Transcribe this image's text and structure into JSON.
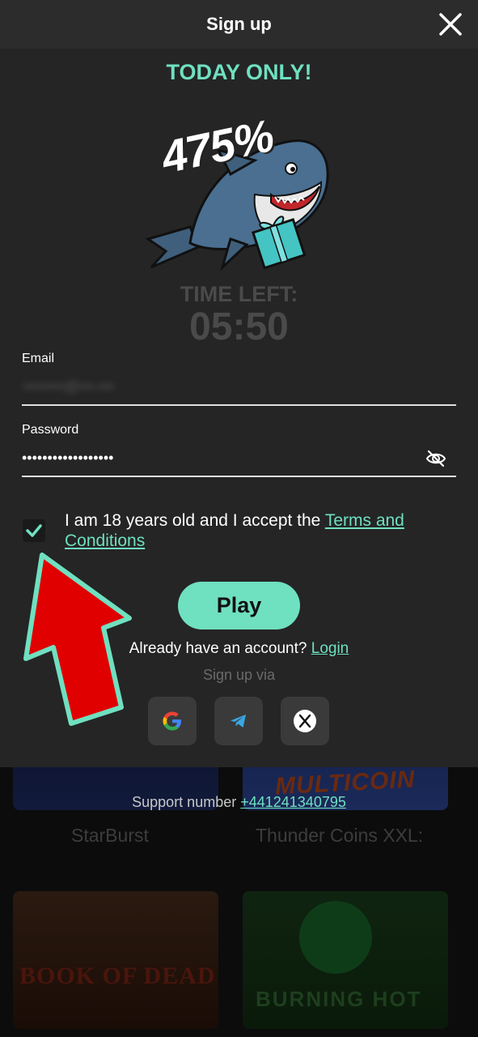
{
  "modal": {
    "title": "Sign up",
    "promo": "TODAY ONLY!",
    "bonus_percent": "475%",
    "time_left_label": "TIME LEFT:",
    "timer": "05:50",
    "email_label": "Email",
    "email_value": "••••••••@•••.•••",
    "password_label": "Password",
    "password_value": "••••••••••••••••••",
    "terms_text": "I am 18 years old and I accept the ",
    "terms_link": "Terms and Conditions",
    "terms_checked": true,
    "play_label": "Play",
    "already_text": "Already have an account? ",
    "login_link": "Login",
    "signup_via": "Sign up via",
    "social": [
      "google-icon",
      "telegram-icon",
      "x-icon"
    ],
    "accent_color": "#6fe0c0"
  },
  "background": {
    "support_text": "Support number ",
    "support_phone": "+441241340795",
    "games": [
      {
        "label": "StarBurst"
      },
      {
        "label": "Thunder Coins XXL:"
      },
      {
        "label": "Book of Dead"
      },
      {
        "label": "Burning Hot"
      }
    ],
    "multicoin_text": "MULTICOIN",
    "book_text": "BOOK OF DEAD",
    "burning_text": "BURNING HOT"
  },
  "overlay": {
    "arrow_color": "#e00000",
    "arrow_outline": "#6fe0c0"
  }
}
